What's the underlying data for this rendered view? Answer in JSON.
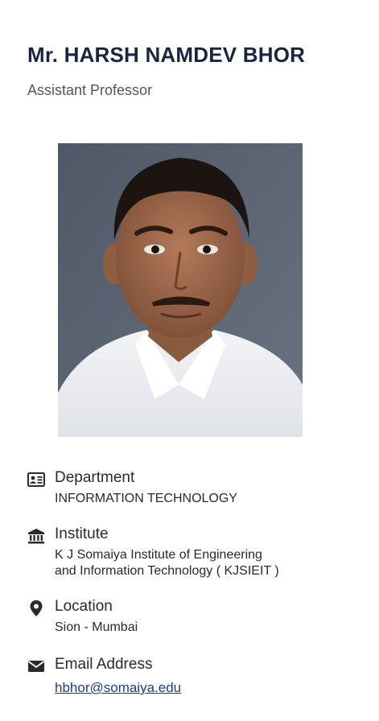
{
  "profile": {
    "name": "Mr. HARSH NAMDEV BHOR",
    "designation": "Assistant Professor",
    "photo_icon": "faculty-portrait"
  },
  "details": {
    "department": {
      "icon": "id-card-icon",
      "label": "Department",
      "value": "INFORMATION TECHNOLOGY"
    },
    "institute": {
      "icon": "institution-building-icon",
      "label": "Institute",
      "value_line1": "K J Somaiya Institute of Engineering",
      "value_line2": "and Information Technology ( KJSIEIT )"
    },
    "location": {
      "icon": "map-pin-icon",
      "label": "Location",
      "value": "Sion - Mumbai"
    },
    "email": {
      "icon": "envelope-icon",
      "label": "Email Address",
      "value": "hbhor@somaiya.edu",
      "href": "mailto:hbhor@somaiya.edu"
    }
  },
  "colors": {
    "name": "#1b2540",
    "text": "#2a2a2a",
    "muted": "#555555",
    "link": "#1a3d8f"
  }
}
